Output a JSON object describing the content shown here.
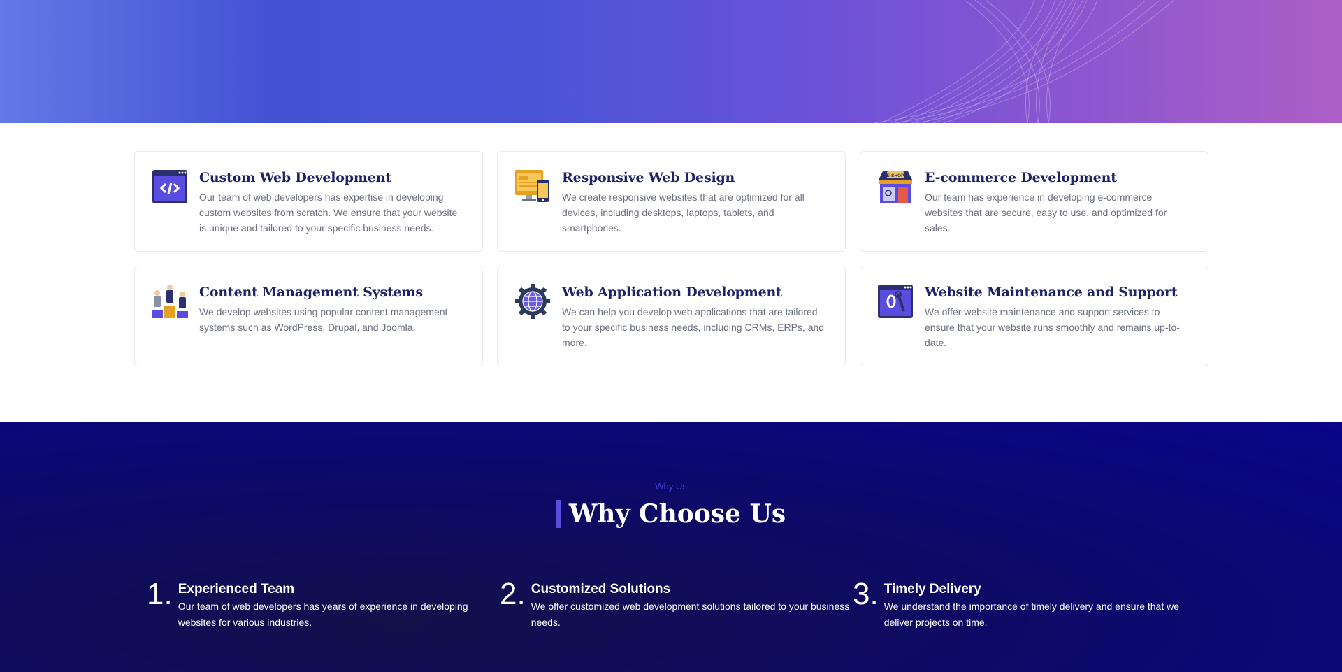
{
  "services": [
    {
      "title": "Custom Web Development",
      "text": "Our team of web developers has expertise in developing custom websites from scratch. We ensure that your website is unique and tailored to your specific business needs.",
      "icon": "code-window-icon"
    },
    {
      "title": "Responsive Web Design",
      "text": "We create responsive websites that are optimized for all devices, including desktops, laptops, tablets, and smartphones.",
      "icon": "devices-icon"
    },
    {
      "title": "E-commerce Development",
      "text": "Our team has experience in developing e-commerce websites that are secure, easy to use, and optimized for sales.",
      "icon": "e-shop-icon",
      "icon_text": "E-SHOP"
    },
    {
      "title": "Content Management Systems",
      "text": "We develop websites using popular content management systems such as WordPress, Drupal, and Joomla.",
      "icon": "team-podium-icon"
    },
    {
      "title": "Web Application Development",
      "text": "We can help you develop web applications that are tailored to your specific business needs, including CRMs, ERPs, and more.",
      "icon": "globe-gear-icon"
    },
    {
      "title": "Website Maintenance and Support",
      "text": "We offer website maintenance and support services to ensure that your website runs smoothly and remains up-to-date.",
      "icon": "maintenance-tools-icon"
    }
  ],
  "why": {
    "kicker": "Why Us",
    "heading": "Why Choose Us",
    "items": [
      {
        "num": "1.",
        "title": "Experienced Team",
        "text": "Our team of web developers has years of experience in developing websites for various industries."
      },
      {
        "num": "2.",
        "title": "Customized Solutions",
        "text": "We offer customized web development solutions tailored to your business needs."
      },
      {
        "num": "3.",
        "title": "Timely Delivery",
        "text": "We understand the importance of timely delivery and ensure that we deliver projects on time."
      }
    ]
  },
  "colors": {
    "card_title": "#1e2366",
    "card_text": "#6b6f80",
    "accent": "#5b4ce0",
    "why_bg": "#0d0a66"
  }
}
